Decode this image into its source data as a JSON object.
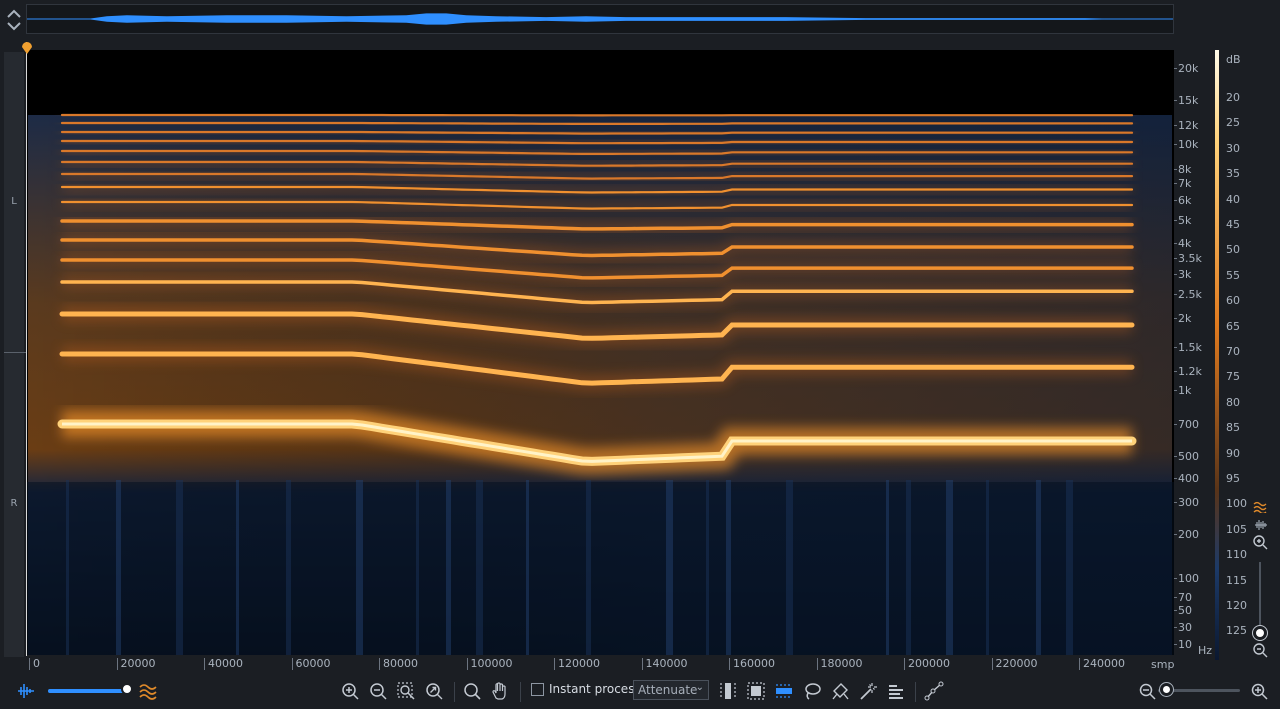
{
  "channels": {
    "left": "L",
    "right": "R"
  },
  "frequency_axis": {
    "unit": "Hz",
    "ticks": [
      "20k",
      "15k",
      "12k",
      "10k",
      "8k",
      "7k",
      "6k",
      "5k",
      "4k",
      "3.5k",
      "3k",
      "2.5k",
      "2k",
      "1.5k",
      "1.2k",
      "1k",
      "700",
      "500",
      "400",
      "300",
      "200",
      "100",
      "70",
      "50",
      "30",
      "10"
    ]
  },
  "db_scale": {
    "unit": "dB",
    "ticks": [
      "20",
      "25",
      "30",
      "35",
      "40",
      "45",
      "50",
      "55",
      "60",
      "65",
      "70",
      "75",
      "80",
      "85",
      "90",
      "95",
      "100",
      "105",
      "110",
      "115",
      "120",
      "125"
    ]
  },
  "time_axis": {
    "unit": "smp",
    "ticks": [
      "0",
      "20000",
      "40000",
      "60000",
      "80000",
      "100000",
      "120000",
      "140000",
      "160000",
      "180000",
      "200000",
      "220000",
      "240000"
    ]
  },
  "toolbar": {
    "instant_process_label": "Instant process",
    "instant_process_checked": false,
    "mode_value": "Attenuate",
    "mode_options": [
      "Attenuate"
    ]
  },
  "colors": {
    "accent": "#2f8fff",
    "spectrogram_hot": "#ffd27a",
    "spectrogram_warm": "#e07a1e",
    "spectrogram_cold": "#102a52",
    "playhead_marker": "#f0a030"
  },
  "icons": {
    "overview_toggle": "up-down-chevron-icon",
    "waveform_view": "waveform-icon",
    "spectrogram_view": "spectrogram-icon",
    "zoom_in": "zoom-in-icon",
    "zoom_out": "zoom-out-icon",
    "zoom_selection": "zoom-selection-icon",
    "zoom_fit": "zoom-fit-icon",
    "magnify": "magnify-icon",
    "hand": "hand-icon",
    "time_select": "time-selection-icon",
    "time_freq_select": "time-frequency-selection-icon",
    "freq_select": "frequency-selection-icon",
    "lasso": "lasso-icon",
    "brush": "brush-icon",
    "magic_wand": "magic-wand-icon",
    "harmonic_select": "harmonic-selection-icon",
    "curve": "curve-icon"
  }
}
